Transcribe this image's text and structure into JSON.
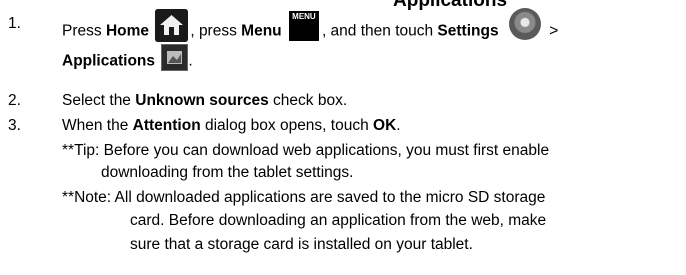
{
  "heading_fragment": "Applications",
  "steps": [
    {
      "number": "1.",
      "parts": {
        "press": "Press ",
        "home": "Home",
        "comma_press": ", press ",
        "menu": "Menu",
        "and_touch": ", and then touch ",
        "settings": "Settings",
        "gt": " >",
        "applications": "Applications",
        "period": "."
      },
      "menu_icon_text": "MENU"
    },
    {
      "number": "2.",
      "parts": {
        "select": "Select the ",
        "unknown_sources": "Unknown sources",
        "check_box": " check box."
      }
    },
    {
      "number": "3.",
      "parts": {
        "when": "When the ",
        "attention": "Attention",
        "dialog_opens": " dialog box opens, touch ",
        "ok": "OK",
        "period": "."
      }
    }
  ],
  "tip": {
    "line1": "**Tip:  Before you can download web applications, you must first enable",
    "line2": "downloading from the tablet settings."
  },
  "note": {
    "line1": "**Note:  All downloaded applications are saved to the micro SD storage",
    "line2": "card.  Before downloading an application from the web, make",
    "line3": "sure that a storage card is installed on your tablet."
  },
  "icons": {
    "home": "home-icon",
    "menu": "menu-icon",
    "settings": "settings-gear-icon",
    "applications": "applications-icon"
  }
}
